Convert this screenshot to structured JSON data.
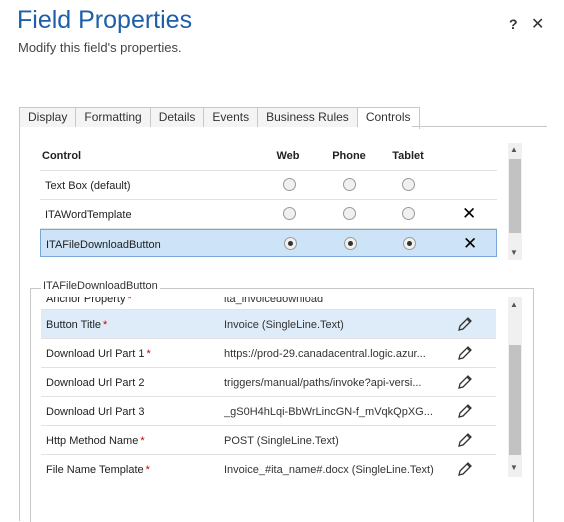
{
  "dialog": {
    "title": "Field Properties",
    "subtitle": "Modify this field's properties.",
    "help_label": "?",
    "close_label": "✕"
  },
  "tabs": [
    "Display",
    "Formatting",
    "Details",
    "Events",
    "Business Rules",
    "Controls"
  ],
  "active_tab": "Controls",
  "controls_table": {
    "headers": {
      "control": "Control",
      "web": "Web",
      "phone": "Phone",
      "tablet": "Tablet"
    },
    "rows": [
      {
        "name": "Text Box (default)",
        "web": false,
        "phone": false,
        "tablet": false,
        "deletable": false
      },
      {
        "name": "ITAWordTemplate",
        "web": false,
        "phone": false,
        "tablet": false,
        "deletable": true
      },
      {
        "name": "ITAFileDownloadButton",
        "web": true,
        "phone": true,
        "tablet": true,
        "deletable": true,
        "selected": true
      }
    ],
    "delete_glyph": "✕"
  },
  "properties": {
    "legend": "ITAFileDownloadButton",
    "rows": [
      {
        "name": "Anchor Property",
        "required": true,
        "value": "ita_invoicedownload"
      },
      {
        "name": "Button Title",
        "required": true,
        "value": "Invoice (SingleLine.Text)",
        "selected": true
      },
      {
        "name": "Download Url Part 1",
        "required": true,
        "value": "https://prod-29.canadacentral.logic.azur..."
      },
      {
        "name": "Download Url Part 2",
        "required": false,
        "value": "triggers/manual/paths/invoke?api-versi..."
      },
      {
        "name": "Download Url Part 3",
        "required": false,
        "value": "_gS0H4hLqi-BbWrLincGN-f_mVqkQpXG..."
      },
      {
        "name": "Http Method Name",
        "required": true,
        "value": "POST (SingleLine.Text)"
      },
      {
        "name": "File Name Template",
        "required": true,
        "value": "Invoice_#ita_name#.docx (SingleLine.Text)"
      }
    ],
    "required_marker": "*"
  },
  "icons": {
    "edit": "pencil-icon",
    "delete": "x-icon",
    "scroll_up": "up-arrow-icon",
    "scroll_down": "down-arrow-icon"
  },
  "colors": {
    "title": "#1e5fa8",
    "selected_row": "#cde3f7",
    "required": "#cc0000"
  }
}
